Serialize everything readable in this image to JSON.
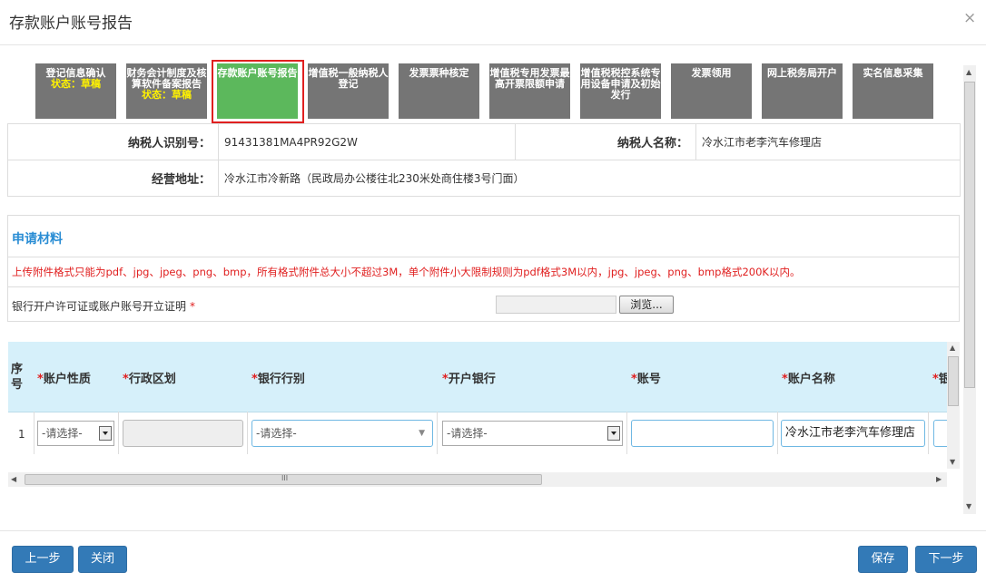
{
  "dialog": {
    "title": "存款账户账号报告",
    "close_glyph": "×"
  },
  "steps": [
    {
      "label": "登记信息确认",
      "status": "状态：草稿"
    },
    {
      "label": "财务会计制度及核算软件备案报告",
      "status": "状态：草稿"
    },
    {
      "label": "存款账户账号报告",
      "status": ""
    },
    {
      "label": "增值税一般纳税人登记",
      "status": ""
    },
    {
      "label": "发票票种核定",
      "status": ""
    },
    {
      "label": "增值税专用发票最高开票限额申请",
      "status": ""
    },
    {
      "label": "增值税税控系统专用设备申请及初始发行",
      "status": ""
    },
    {
      "label": "发票领用",
      "status": ""
    },
    {
      "label": "网上税务局开户",
      "status": ""
    },
    {
      "label": "实名信息采集",
      "status": ""
    }
  ],
  "info": {
    "taxpayer_id_label": "纳税人识别号：",
    "taxpayer_id": "91431381MA4PR92G2W",
    "taxpayer_name_label": "纳税人名称：",
    "taxpayer_name": "冷水江市老李汽车修理店",
    "address_label": "经营地址：",
    "address": "冷水江市冷新路（民政局办公楼往北230米处商住楼3号门面）"
  },
  "materials": {
    "title": "申请材料",
    "warning": "上传附件格式只能为pdf、jpg、jpeg、png、bmp，所有格式附件总大小不超过3M，单个附件小大限制规则为pdf格式3M以内，jpg、jpeg、png、bmp格式200K以内。",
    "attachment_label": "银行开户许可证或账户账号开立证明",
    "required_mark": "*",
    "browse_label": "浏览..."
  },
  "grid": {
    "columns": {
      "seq": "序号",
      "account_type": "账户性质",
      "region": "行政区划",
      "bank_type": "银行行别",
      "bank": "开户银行",
      "account_no": "账号",
      "account_name": "账户名称",
      "cut": "银"
    },
    "required_mark": "*",
    "row": {
      "seq": "1",
      "account_type": "-请选择-",
      "region": "",
      "bank_type": "-请选择-",
      "bank": "-请选择-",
      "account_no": "",
      "account_name": "冷水江市老李汽车修理店"
    },
    "hscroll_grip": "III"
  },
  "footer": {
    "prev": "上一步",
    "close": "关闭",
    "save": "保存",
    "next": "下一步"
  },
  "colors": {
    "accent": "#337ab7",
    "step_gray": "#757575",
    "step_active": "#5cb85c",
    "status_yellow": "#fff200",
    "warn_red": "#e02020",
    "grid_header": "#d6f0fa"
  }
}
